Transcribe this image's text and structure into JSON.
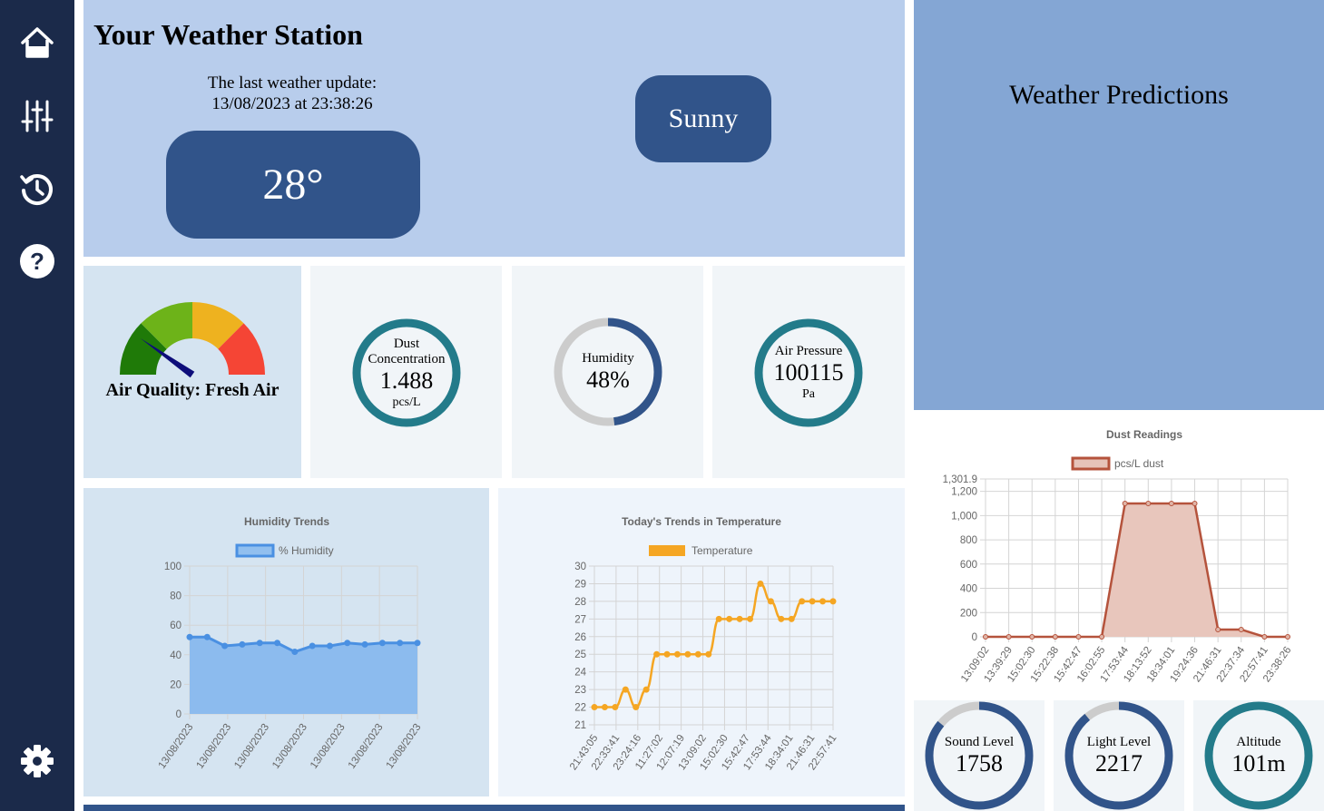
{
  "sidebar": {
    "items": [
      {
        "name": "home",
        "icon": "home-icon"
      },
      {
        "name": "controls",
        "icon": "sliders-icon"
      },
      {
        "name": "history",
        "icon": "history-icon"
      },
      {
        "name": "help",
        "icon": "help-icon"
      },
      {
        "name": "settings",
        "icon": "gear-icon"
      }
    ]
  },
  "header": {
    "title": "Your Weather Station",
    "update_label": "The last weather update:",
    "update_time": "13/08/2023 at 23:38:26",
    "temperature": "28°",
    "condition": "Sunny"
  },
  "predictions": {
    "title": "Weather Predictions"
  },
  "air_quality": {
    "label": "Air Quality: Fresh Air",
    "level": 0.1
  },
  "dust": {
    "label_line1": "Dust",
    "label_line2": "Concentration",
    "value": "1.488",
    "unit": "pcs/L",
    "fill": 1.0
  },
  "humidity": {
    "label": "Humidity",
    "value": "48%",
    "fill": 0.48
  },
  "pressure": {
    "label": "Air Pressure",
    "value": "100115",
    "unit": "Pa",
    "fill": 1.0
  },
  "sound": {
    "label": "Sound Level",
    "value": "1758",
    "fill": 0.86
  },
  "light": {
    "label": "Light Level",
    "value": "2217",
    "fill": 0.89
  },
  "altitude": {
    "label": "Altitude",
    "value": "101m",
    "fill": 1.0
  },
  "colors": {
    "sidebar": "#1b2a4a",
    "accent": "#31548a",
    "ring_teal": "#237b8a",
    "ring_gray": "#cccccc",
    "humidity_line": "#4a90e2",
    "temp_line": "#f5a623",
    "dust_line": "#b5533c"
  },
  "chart_data": [
    {
      "type": "area",
      "title": "Humidity Trends",
      "series": [
        {
          "name": "% Humidity",
          "values": [
            52,
            52,
            46,
            47,
            48,
            48,
            42,
            46,
            46,
            48,
            47,
            48,
            48,
            48
          ]
        }
      ],
      "x": [
        "13/08/2023",
        "13/08/2023",
        "13/08/2023",
        "13/08/2023",
        "13/08/2023",
        "13/08/2023",
        "13/08/2023"
      ],
      "yticks": [
        0,
        20,
        40,
        60,
        80,
        100
      ],
      "ylim": [
        0,
        100
      ],
      "grid": true,
      "legend": "top"
    },
    {
      "type": "line",
      "title": "Today's Trends in Temperature",
      "series": [
        {
          "name": "Temperature",
          "values": [
            22,
            22,
            22,
            23,
            22,
            23,
            25,
            25,
            25,
            25,
            25,
            25,
            27,
            27,
            27,
            27,
            29,
            28,
            27,
            27,
            28,
            28,
            28,
            28
          ]
        }
      ],
      "x": [
        "21:43:05",
        "22:33:41",
        "23:24:16",
        "11:27:02",
        "12:07:19",
        "13:09:02",
        "15:02:30",
        "15:42:47",
        "17:53:44",
        "18:34:01",
        "21:46:31",
        "22:57:41"
      ],
      "yticks": [
        21,
        22,
        23,
        24,
        25,
        26,
        27,
        28,
        29,
        30
      ],
      "ylim": [
        21,
        30
      ],
      "grid": true,
      "legend": "top"
    },
    {
      "type": "area",
      "title": "Dust Readings",
      "series": [
        {
          "name": "pcs/L dust",
          "values": [
            0,
            0,
            0,
            0,
            0,
            0,
            1100,
            1100,
            1100,
            1100,
            60,
            60,
            0,
            0
          ]
        }
      ],
      "x": [
        "13:09:02",
        "13:39:29",
        "15:02:30",
        "15:22:38",
        "15:42:47",
        "16:02:55",
        "17:53:44",
        "18:13:52",
        "18:34:01",
        "19:24:36",
        "21:46:31",
        "22:37:34",
        "22:57:41",
        "23:38:26"
      ],
      "yticks": [
        "0",
        "200",
        "400",
        "600",
        "800",
        "1,000",
        "1,200",
        "1,301.9"
      ],
      "ylim": [
        0,
        1301.9
      ],
      "grid": true,
      "legend": "top"
    }
  ]
}
